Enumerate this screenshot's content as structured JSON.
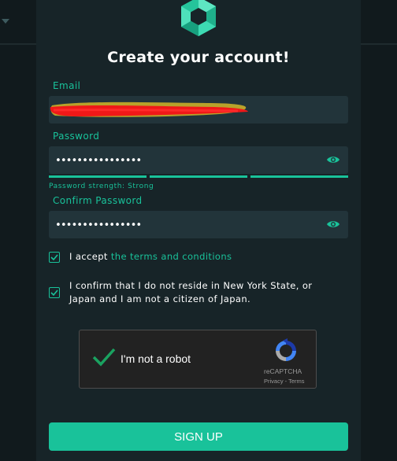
{
  "colors": {
    "accent": "#19c29a",
    "modal_bg": "#172428",
    "input_bg": "#22343a",
    "page_bg": "#0d1416"
  },
  "logo": {
    "icon": "hexagon-logo-icon"
  },
  "form": {
    "title": "Create your account!",
    "email": {
      "label": "Email",
      "value": "",
      "redacted": true
    },
    "password": {
      "label": "Password",
      "value": "••••••••••••••••",
      "toggle_icon": "eye-icon"
    },
    "password_strength": {
      "text": "Password strength: Strong",
      "level": 3,
      "max_level": 3
    },
    "confirm_password": {
      "label": "Confirm Password",
      "value": "••••••••••••••••",
      "toggle_icon": "eye-icon"
    },
    "terms": {
      "checked": true,
      "prefix": "I accept ",
      "link": "the terms and conditions"
    },
    "residency": {
      "checked": true,
      "line1": "I confirm that I do not reside in New York State, or",
      "line2": "Japan and I am not a citizen of Japan."
    },
    "recaptcha": {
      "label": "I'm not a robot",
      "brand": "reCAPTCHA",
      "links": "Privacy - Terms",
      "checked": true
    },
    "submit_label": "SIGN UP"
  }
}
